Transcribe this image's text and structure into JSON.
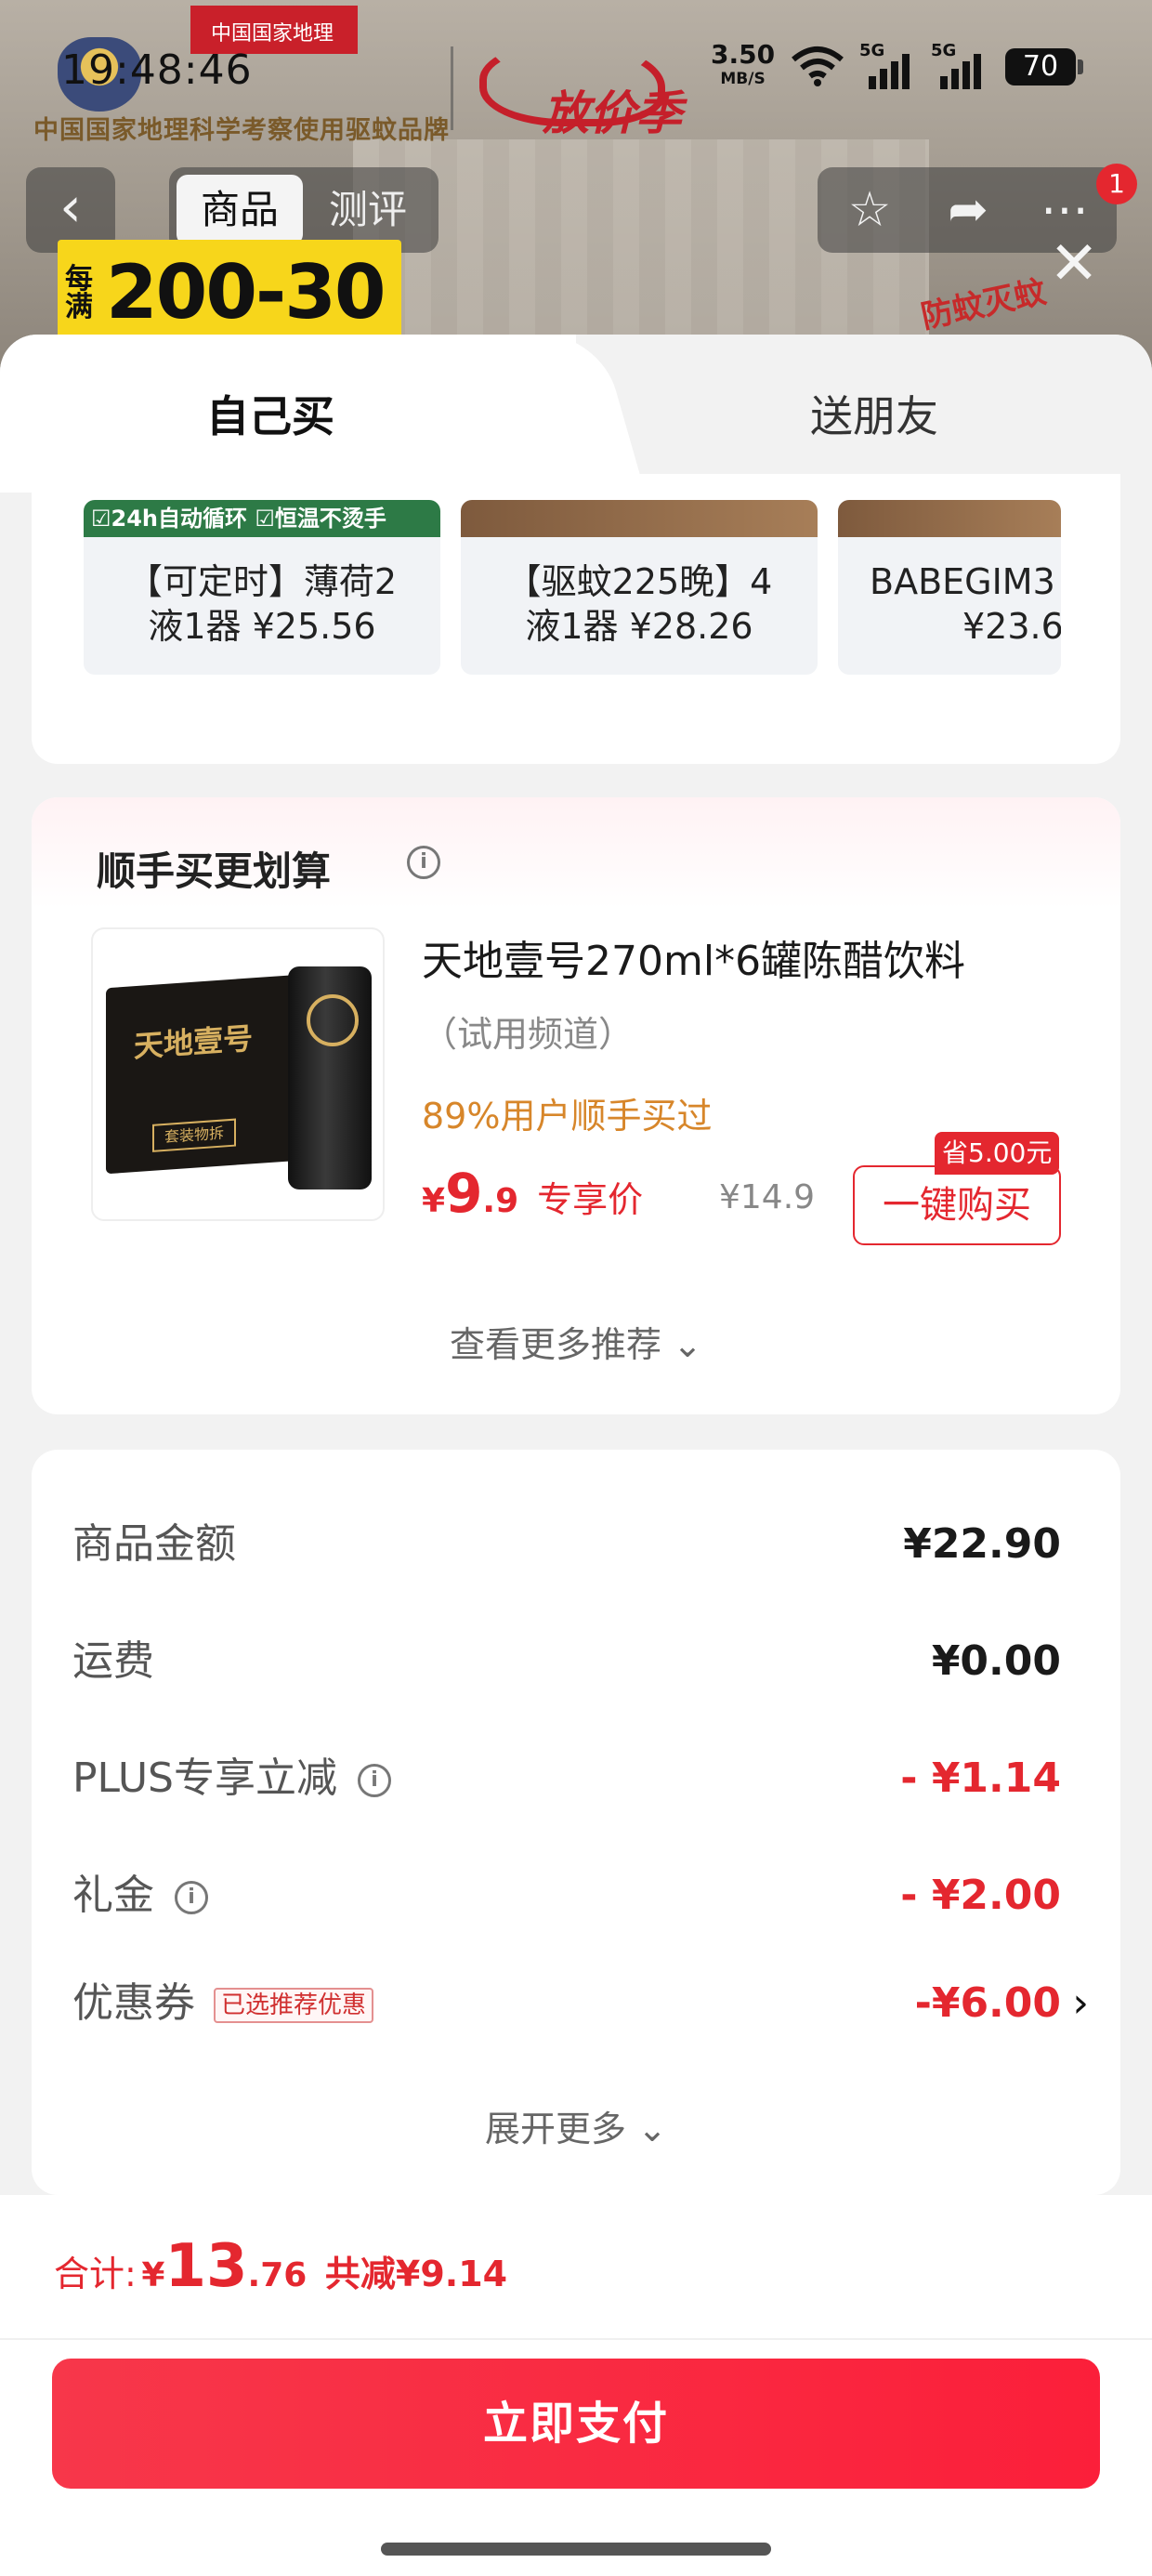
{
  "status_bar": {
    "time": "19:48:46",
    "net_speed": "3.50",
    "net_unit": "MB/S",
    "signal_label_1": "5G",
    "signal_label_2": "5G",
    "battery": "70"
  },
  "backdrop": {
    "brand_badge": "中国国家地理",
    "brand_line": "中国国家地理科学考察使用驱蚊品牌",
    "campaign_text": "放价季",
    "promo_small": "每满",
    "promo_big": "200-30",
    "stamp_text": "防蚊灭蚊",
    "cart_badge_count": "1"
  },
  "nav": {
    "back_glyph": "‹",
    "tabs": [
      "商品",
      "测评"
    ],
    "right_icons": [
      "star-icon",
      "share-icon",
      "more-icon"
    ]
  },
  "sheet": {
    "tabs": [
      "自己买",
      "送朋友"
    ],
    "close_glyph": "✕"
  },
  "product_strip": [
    {
      "banner": "☑24h自动循环 ☑恒温不烫手",
      "name_line1": "【可定时】薄荷2",
      "name_line2": "液1器 ¥25.56"
    },
    {
      "banner": "",
      "name_line1": "【驱蚊225晚】4",
      "name_line2": "液1器 ¥28.26"
    },
    {
      "banner": "",
      "name_line1": "BABEGIM3",
      "name_line2": "¥23.6"
    }
  ],
  "combo": {
    "title": "顺手买更划算",
    "product_name": "天地壹号270ml*6罐陈醋饮料",
    "product_sub": "（试用频道）",
    "bought_text": "89%用户顺手买过",
    "price_currency": "¥",
    "price_int": "9",
    "price_dec": ".9",
    "price_label": "专享价",
    "original_price": "¥14.9",
    "save_badge": "省5.00元",
    "buy_button": "一键购买",
    "more_rec": "查看更多推荐 ⌄",
    "img_text": "天地壹号",
    "img_tag": "套装物拆"
  },
  "summary": {
    "rows": [
      {
        "label": "商品金额",
        "value": "¥22.90"
      },
      {
        "label": "运费",
        "value": "¥0.00"
      },
      {
        "label": "PLUS专享立减",
        "value": "- ¥1.14"
      },
      {
        "label": "礼金",
        "value": "- ¥2.00"
      },
      {
        "label": "优惠券",
        "value": "-¥6.00",
        "tag": "已选推荐优惠"
      }
    ],
    "expand": "展开更多 ⌄",
    "colors": {
      "discount": "#e4272f"
    }
  },
  "footer": {
    "total_label": "合计:",
    "total_currency": "¥",
    "total_int": "13",
    "total_dec": ".76",
    "discount_text": "共减¥9.14",
    "pay_button": "立即支付"
  }
}
